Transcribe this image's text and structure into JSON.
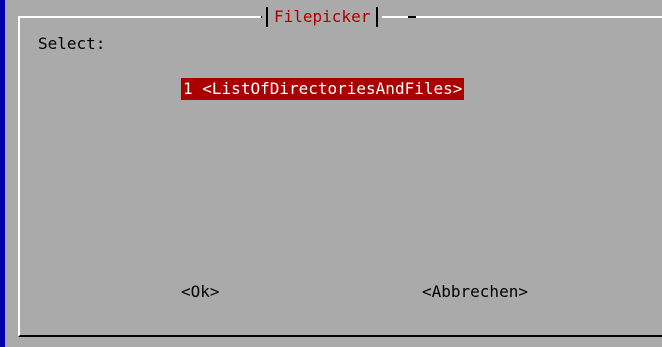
{
  "colors": {
    "background": "#aaaaaa",
    "title": "#aa0000",
    "selection_bg": "#aa0000",
    "selection_fg": "#ffffff",
    "screen_edge": "#0000aa"
  },
  "dialog": {
    "title": "Filepicker",
    "prompt": "Select:",
    "items": [
      {
        "tag": "1",
        "label": "<ListOfDirectoriesAndFiles>",
        "selected": true
      }
    ],
    "buttons": {
      "ok": "<Ok>",
      "cancel": "<Abbrechen>"
    }
  }
}
